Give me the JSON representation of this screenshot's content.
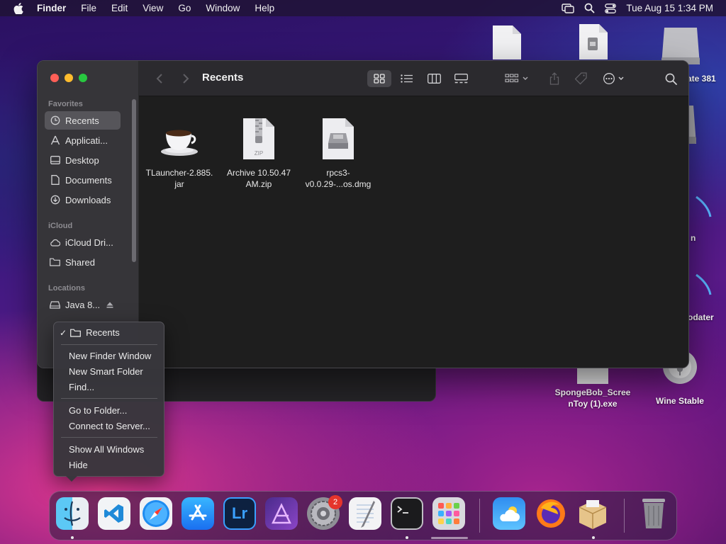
{
  "menubar": {
    "app_name": "Finder",
    "menus": [
      "File",
      "Edit",
      "View",
      "Go",
      "Window",
      "Help"
    ],
    "clock": "Tue Aug 15  1:34 PM",
    "status_icons": [
      "screen-mirroring-icon",
      "spotlight-icon",
      "control-center-icon"
    ]
  },
  "desktop": {
    "icons": [
      {
        "label": "",
        "icon": "document-icon"
      },
      {
        "label": "",
        "icon": "zip-document-icon"
      },
      {
        "label": "ate 381",
        "icon": "drive-icon"
      },
      {
        "label": "n",
        "icon": "app-icon"
      },
      {
        "label": "odater",
        "icon": "app-icon"
      },
      {
        "label": "SpongeBob_ScreenToy (1).exe",
        "icon": "exe-document-icon"
      },
      {
        "label": "Wine Stable",
        "icon": "wine-icon"
      }
    ],
    "spongebob_line1": "SpongeBob_Scree",
    "spongebob_line2": "nToy (1).exe"
  },
  "finder": {
    "title": "Recents",
    "sidebar": {
      "favorites_header": "Favorites",
      "favorites": [
        "Recents",
        "Applicati...",
        "Desktop",
        "Documents",
        "Downloads"
      ],
      "icloud_header": "iCloud",
      "icloud": [
        "iCloud Dri...",
        "Shared"
      ],
      "locations_header": "Locations",
      "locations": [
        "Java 8..."
      ]
    },
    "files": [
      {
        "line1": "TLauncher-2.885.",
        "line2": "jar",
        "icon": "java-cup-icon"
      },
      {
        "line1": "Archive 10.50.47",
        "line2": "AM.zip",
        "icon": "zip-file-icon",
        "icon_text": "ZIP"
      },
      {
        "line1": "rpcs3-",
        "line2": "v0.0.29-...os.dmg",
        "icon": "disk-image-icon"
      }
    ]
  },
  "context_menu": {
    "current_window": "Recents",
    "items": [
      "New Finder Window",
      "New Smart Folder",
      "Find...",
      "Go to Folder...",
      "Connect to Server...",
      "Show All Windows",
      "Hide"
    ]
  },
  "dock": {
    "apps": [
      "Finder",
      "Visual Studio Code",
      "Safari",
      "App Store",
      "Lightroom",
      "Affinity Photo",
      "System Settings",
      "TextEdit",
      "Terminal",
      "Launchpad",
      "Weather",
      "Firefox",
      "Archive Utility",
      "Trash"
    ],
    "lightroom_label": "Lr",
    "system_settings_badge": "2"
  }
}
